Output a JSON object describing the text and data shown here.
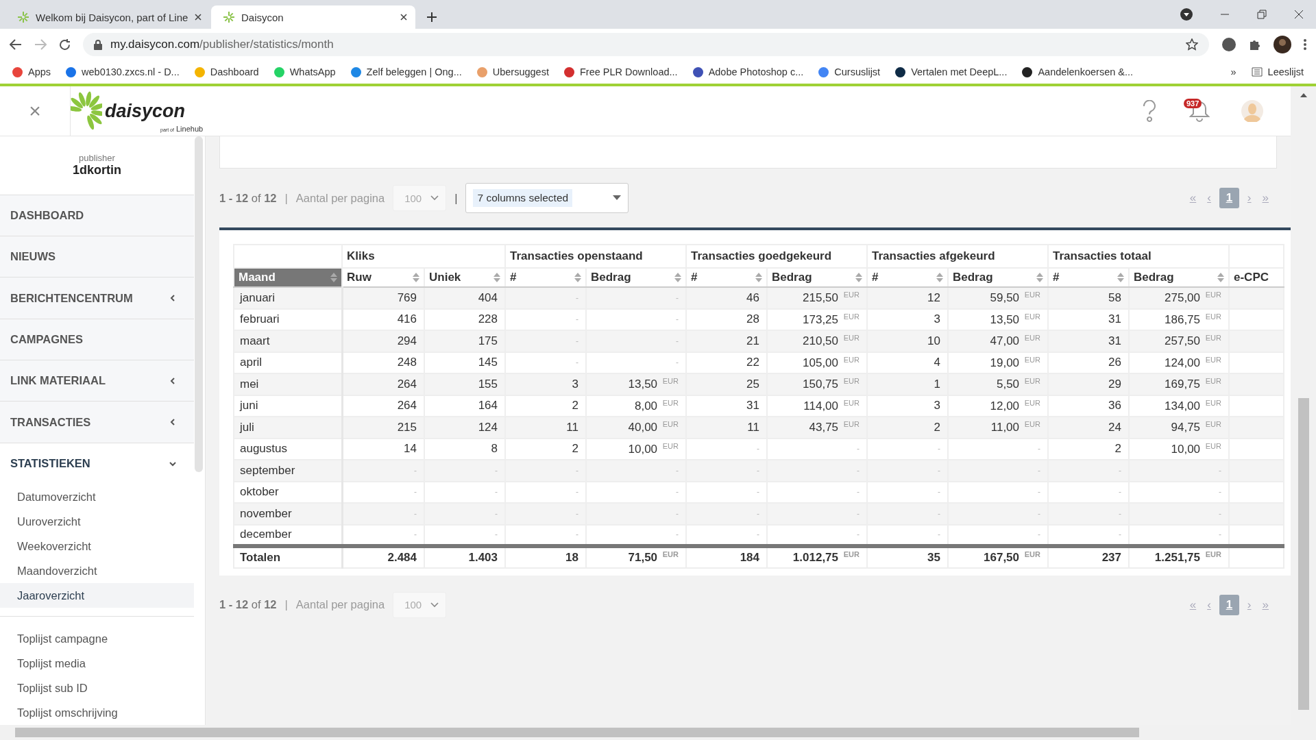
{
  "browser": {
    "tabs": [
      {
        "title": "Welkom bij Daisycon, part of Line",
        "selected": false
      },
      {
        "title": "Daisycon",
        "selected": true
      }
    ],
    "url_host": "my.daisycon.com",
    "url_path": "/publisher/statistics/month",
    "bookmarks": [
      {
        "label": "Apps",
        "color": "#e8453c"
      },
      {
        "label": "web0130.zxcs.nl - D...",
        "color": "#1a73e8"
      },
      {
        "label": "Dashboard",
        "color": "#f4b400"
      },
      {
        "label": "WhatsApp",
        "color": "#25d366"
      },
      {
        "label": "Zelf beleggen | Ong...",
        "color": "#1e88e5"
      },
      {
        "label": "Ubersuggest",
        "color": "#e9a06a"
      },
      {
        "label": "Free PLR Download...",
        "color": "#d32f2f"
      },
      {
        "label": "Adobe Photoshop c...",
        "color": "#3f51b5"
      },
      {
        "label": "Cursuslijst",
        "color": "#4285f4"
      },
      {
        "label": "Vertalen met DeepL...",
        "color": "#0f2b46"
      },
      {
        "label": "Aandelenkoersen &...",
        "color": "#222222"
      }
    ],
    "overflow": "»",
    "reading_list": "Leeslijst"
  },
  "app": {
    "close": "×",
    "logo": {
      "name": "daisycon",
      "prefix": "part of",
      "suffix": "Linehub"
    },
    "notifications": "937"
  },
  "sidebar": {
    "role": "publisher",
    "account": "1dkortin",
    "items": [
      {
        "label": "DASHBOARD"
      },
      {
        "label": "NIEUWS"
      },
      {
        "label": "BERICHTENCENTRUM",
        "expanded": false
      },
      {
        "label": "CAMPAGNES"
      },
      {
        "label": "LINK MATERIAAL",
        "expanded": false
      },
      {
        "label": "TRANSACTIES",
        "expanded": false
      },
      {
        "label": "STATISTIEKEN",
        "expanded": true,
        "children": [
          {
            "label": "Datumoverzicht",
            "selected": false
          },
          {
            "label": "Uuroverzicht",
            "selected": false
          },
          {
            "label": "Weekoverzicht",
            "selected": false
          },
          {
            "label": "Maandoverzicht",
            "selected": false
          },
          {
            "label": "Jaaroverzicht",
            "selected": true
          }
        ],
        "more": [
          {
            "label": "Toplijst campagne",
            "selected": false
          },
          {
            "label": "Toplijst media",
            "selected": false
          },
          {
            "label": "Toplijst sub ID",
            "selected": false
          },
          {
            "label": "Toplijst omschrijving",
            "selected": false
          }
        ]
      }
    ]
  },
  "toolbar": {
    "range": "**1 - 12** of **12**",
    "separator": "|",
    "columns_separator": "|",
    "per_page_label": "Aantal per pagina",
    "per_page": "100",
    "columns": "7 columns selected",
    "pages": [
      {
        "label": "«",
        "selected": false
      },
      {
        "label": "‹",
        "selected": false
      },
      {
        "label": "1",
        "selected": true
      },
      {
        "label": "›",
        "selected": false
      },
      {
        "label": "»",
        "selected": false
      }
    ]
  },
  "table": {
    "first_column": {
      "label": "Maand",
      "selected": true
    },
    "groups": [
      {
        "label": "Kliks",
        "columns": [
          {
            "label": "Ruw",
            "sortable": true
          },
          {
            "label": "Uniek",
            "sortable": true
          }
        ]
      },
      {
        "label": "Transacties openstaand",
        "columns": [
          {
            "label": "#",
            "sortable": true
          },
          {
            "label": "Bedrag",
            "sortable": true
          }
        ]
      },
      {
        "label": "Transacties goedgekeurd",
        "columns": [
          {
            "label": "#",
            "sortable": true
          },
          {
            "label": "Bedrag",
            "sortable": true
          }
        ]
      },
      {
        "label": "Transacties afgekeurd",
        "columns": [
          {
            "label": "#",
            "sortable": true
          },
          {
            "label": "Bedrag",
            "sortable": true
          }
        ]
      },
      {
        "label": "Transacties totaal",
        "columns": [
          {
            "label": "#",
            "sortable": true
          },
          {
            "label": "Bedrag",
            "sortable": true
          }
        ]
      },
      {
        "columns": [
          {
            "label": "e-CPC",
            "sortable": false
          }
        ]
      }
    ],
    "rows": [
      {
        "month": "januari",
        "cells": [
          "769",
          "404",
          "-",
          "-",
          "46",
          "215,50 $^{EUR}$",
          "12",
          "59,50 $^{EUR}$",
          "58",
          "275,00 $^{EUR}$"
        ]
      },
      {
        "month": "februari",
        "cells": [
          "416",
          "228",
          "-",
          "-",
          "28",
          "173,25 $^{EUR}$",
          "3",
          "13,50 $^{EUR}$",
          "31",
          "186,75 $^{EUR}$"
        ]
      },
      {
        "month": "maart",
        "cells": [
          "294",
          "175",
          "-",
          "-",
          "21",
          "210,50 $^{EUR}$",
          "10",
          "47,00 $^{EUR}$",
          "31",
          "257,50 $^{EUR}$"
        ]
      },
      {
        "month": "april",
        "cells": [
          "248",
          "145",
          "-",
          "-",
          "22",
          "105,00 $^{EUR}$",
          "4",
          "19,00 $^{EUR}$",
          "26",
          "124,00 $^{EUR}$"
        ]
      },
      {
        "month": "mei",
        "cells": [
          "264",
          "155",
          "3",
          "13,50 $^{EUR}$",
          "25",
          "150,75 $^{EUR}$",
          "1",
          "5,50 $^{EUR}$",
          "29",
          "169,75 $^{EUR}$"
        ]
      },
      {
        "month": "juni",
        "cells": [
          "264",
          "164",
          "2",
          "8,00 $^{EUR}$",
          "31",
          "114,00 $^{EUR}$",
          "3",
          "12,00 $^{EUR}$",
          "36",
          "134,00 $^{EUR}$"
        ]
      },
      {
        "month": "juli",
        "cells": [
          "215",
          "124",
          "11",
          "40,00 $^{EUR}$",
          "11",
          "43,75 $^{EUR}$",
          "2",
          "11,00 $^{EUR}$",
          "24",
          "94,75 $^{EUR}$"
        ]
      },
      {
        "month": "augustus",
        "cells": [
          "14",
          "8",
          "2",
          "10,00 $^{EUR}$",
          "-",
          "-",
          "-",
          "-",
          "2",
          "10,00 $^{EUR}$"
        ]
      },
      {
        "month": "september",
        "cells": [
          "-",
          "-",
          "-",
          "-",
          "-",
          "-",
          "-",
          "-",
          "-",
          "-"
        ]
      },
      {
        "month": "oktober",
        "cells": [
          "-",
          "-",
          "-",
          "-",
          "-",
          "-",
          "-",
          "-",
          "-",
          "-"
        ]
      },
      {
        "month": "november",
        "cells": [
          "-",
          "-",
          "-",
          "-",
          "-",
          "-",
          "-",
          "-",
          "-",
          "-"
        ]
      },
      {
        "month": "december",
        "cells": [
          "-",
          "-",
          "-",
          "-",
          "-",
          "-",
          "-",
          "-",
          "-",
          "-"
        ]
      }
    ],
    "totals": {
      "label": "Totalen",
      "cells": [
        "2.484",
        "1.403",
        "18",
        "71,50 $^{EUR}$",
        "184",
        "1.012,75 $^{EUR}$",
        "35",
        "167,50 $^{EUR}$",
        "237",
        "1.251,75 $^{EUR}$"
      ]
    }
  },
  "footer_toolbar": {
    "range": "**1 - 12** of **12**",
    "separator": "|",
    "per_page_label": "Aantal per pagina",
    "per_page": "100",
    "pages": [
      {
        "label": "«",
        "selected": false
      },
      {
        "label": "‹",
        "selected": false
      },
      {
        "label": "1",
        "selected": true
      },
      {
        "label": "›",
        "selected": false
      },
      {
        "label": "»",
        "selected": false
      }
    ]
  }
}
